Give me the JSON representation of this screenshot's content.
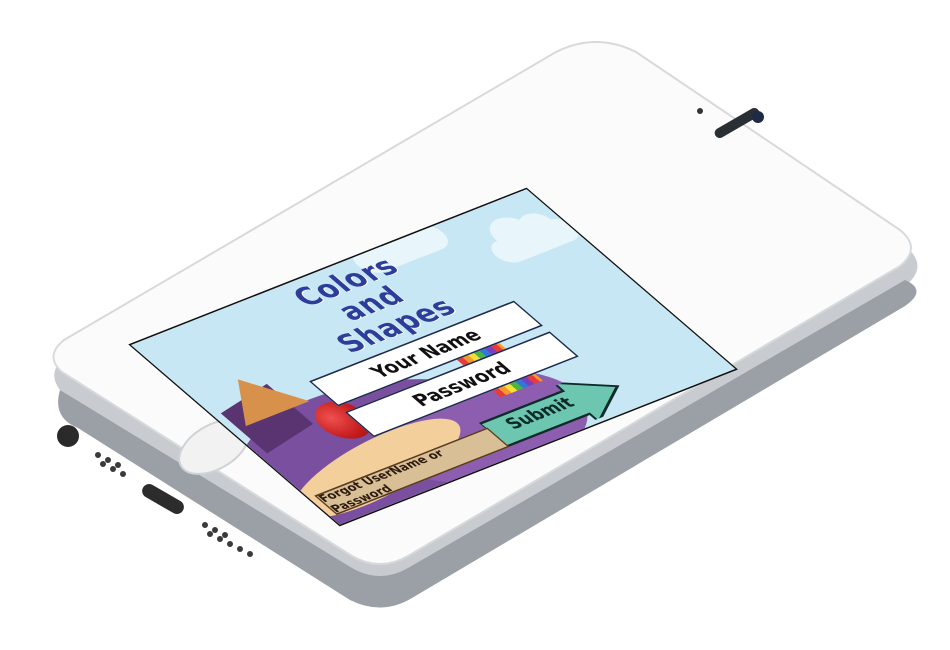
{
  "app": {
    "title_lines": [
      "Colors",
      "and",
      "Shapes"
    ]
  },
  "login": {
    "username_placeholder": "Your Name",
    "password_placeholder": "Password",
    "submit_label": "Submit",
    "forgot_label": "Forgot UserName or Password"
  },
  "colors": {
    "sky": "#c7e7f4",
    "title": "#2d3d9a",
    "submit_arrow": "#6cc6b0",
    "forgot_bg": "#d9bf95",
    "ground": "#7b4fa0"
  },
  "icons": {
    "submit": "arrow-right-icon",
    "speaker": "speaker-slot-icon",
    "camera": "front-camera-icon",
    "home": "home-button-icon"
  }
}
